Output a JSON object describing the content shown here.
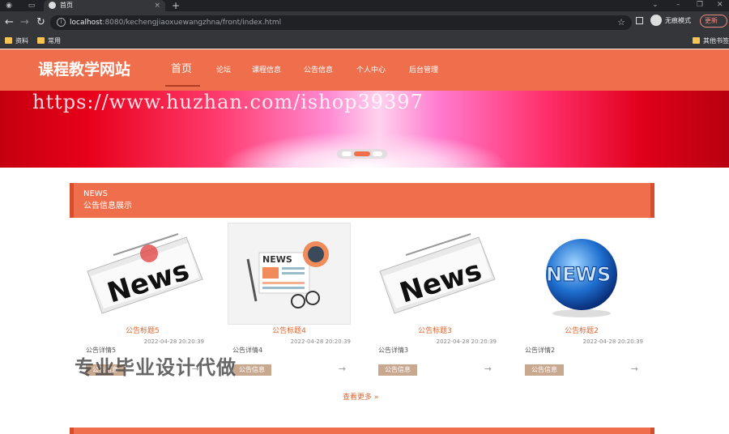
{
  "browser": {
    "tab_title": "首页",
    "close_tab": "×",
    "new_tab": "+",
    "url_host": "localhost",
    "url_rest": ":8080/kechengjiaoxuewangzhna/front/index.html",
    "profile_label": "无痕模式",
    "update_label": "更新",
    "bookmarks": [
      "资料",
      "常用",
      "其他书签"
    ]
  },
  "site": {
    "logo": "课程教学网站",
    "nav": [
      "首页",
      "论坛",
      "课程信息",
      "公告信息",
      "个人中心",
      "后台管理"
    ],
    "accent_color": "#ef6f4d"
  },
  "banner": {
    "watermark": "https://www.huzhan.com/ishop39397",
    "slides": 3,
    "active_slide": 2
  },
  "news": {
    "heading_en": "NEWS",
    "heading_cn": "公告信息展示",
    "cards": [
      {
        "title": "公告标题5",
        "date": "2022-04-28 20:20:39",
        "detail": "公告详情5",
        "tag": "公告信息",
        "image": "newspaper-icon"
      },
      {
        "title": "公告标题4",
        "date": "2022-04-28 20:20:39",
        "detail": "公告详情4",
        "tag": "公告信息",
        "image": "news-flat-icon"
      },
      {
        "title": "公告标题3",
        "date": "2022-04-28 20:20:39",
        "detail": "公告详情3",
        "tag": "公告信息",
        "image": "newspaper-icon"
      },
      {
        "title": "公告标题2",
        "date": "2022-04-28 20:20:39",
        "detail": "公告详情2",
        "tag": "公告信息",
        "image": "news-globe-icon"
      }
    ],
    "arrow": "→",
    "more": "查看更多 »"
  },
  "overlay": {
    "promo": "专业毕业设计代做"
  }
}
